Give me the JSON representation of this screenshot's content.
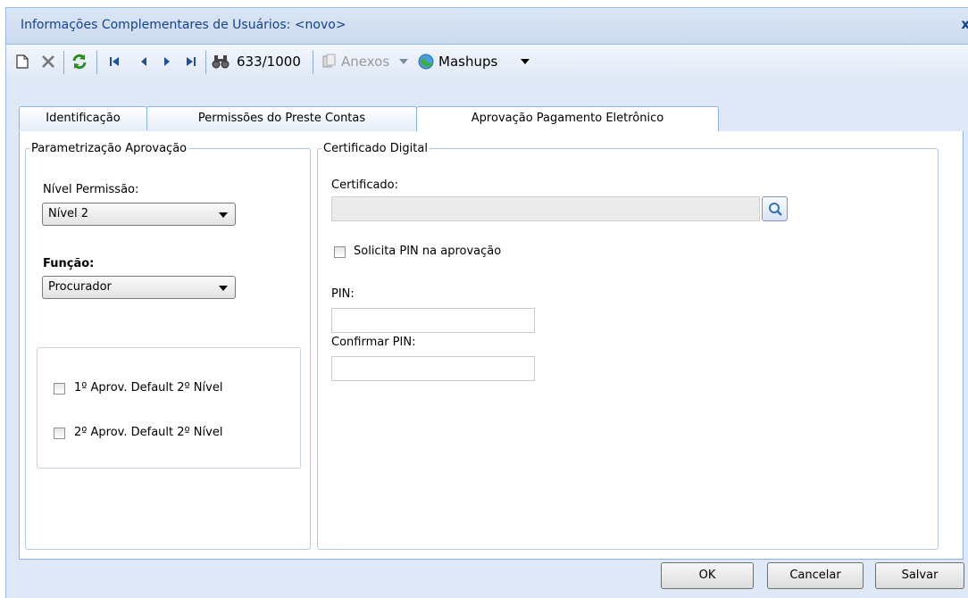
{
  "window": {
    "title": "Informações Complementares de Usuários: <novo>",
    "close_label": "x"
  },
  "toolbar": {
    "record_counter": "633/1000",
    "anexos_label": "Anexos",
    "mashups_label": "Mashups",
    "icons": [
      "new-document-icon",
      "delete-icon",
      "refresh-icon",
      "first-record-icon",
      "previous-record-icon",
      "next-record-icon",
      "last-record-icon",
      "search-binoculars-icon",
      "attachments-icon",
      "mashups-globe-icon"
    ]
  },
  "tabs": [
    {
      "label": "Identificação",
      "active": false
    },
    {
      "label": "Permissões do Preste Contas",
      "active": false
    },
    {
      "label": "Aprovação Pagamento Eletrônico",
      "active": true
    }
  ],
  "param_panel": {
    "legend": "Parametrização Aprovação",
    "nivel_label": "Nível Permissão:",
    "nivel_value": "Nível 2",
    "funcao_label": "Função:",
    "funcao_value": "Procurador",
    "check1_label": "1º Aprov. Default 2º Nível",
    "check2_label": "2º Aprov. Default 2º Nível"
  },
  "cert_panel": {
    "legend": "Certificado Digital",
    "certificado_label": "Certificado:",
    "certificado_value": "",
    "pin_check_label": "Solicita PIN na aprovação",
    "pin_label": "PIN:",
    "pin_value": "",
    "confirm_pin_label": "Confirmar PIN:",
    "confirm_pin_value": ""
  },
  "buttons": {
    "ok": "OK",
    "cancel": "Cancelar",
    "save": "Salvar"
  },
  "colors": {
    "title_text": "#15428b",
    "window_bg": "#dfe8f6",
    "border": "#99bbe8"
  }
}
